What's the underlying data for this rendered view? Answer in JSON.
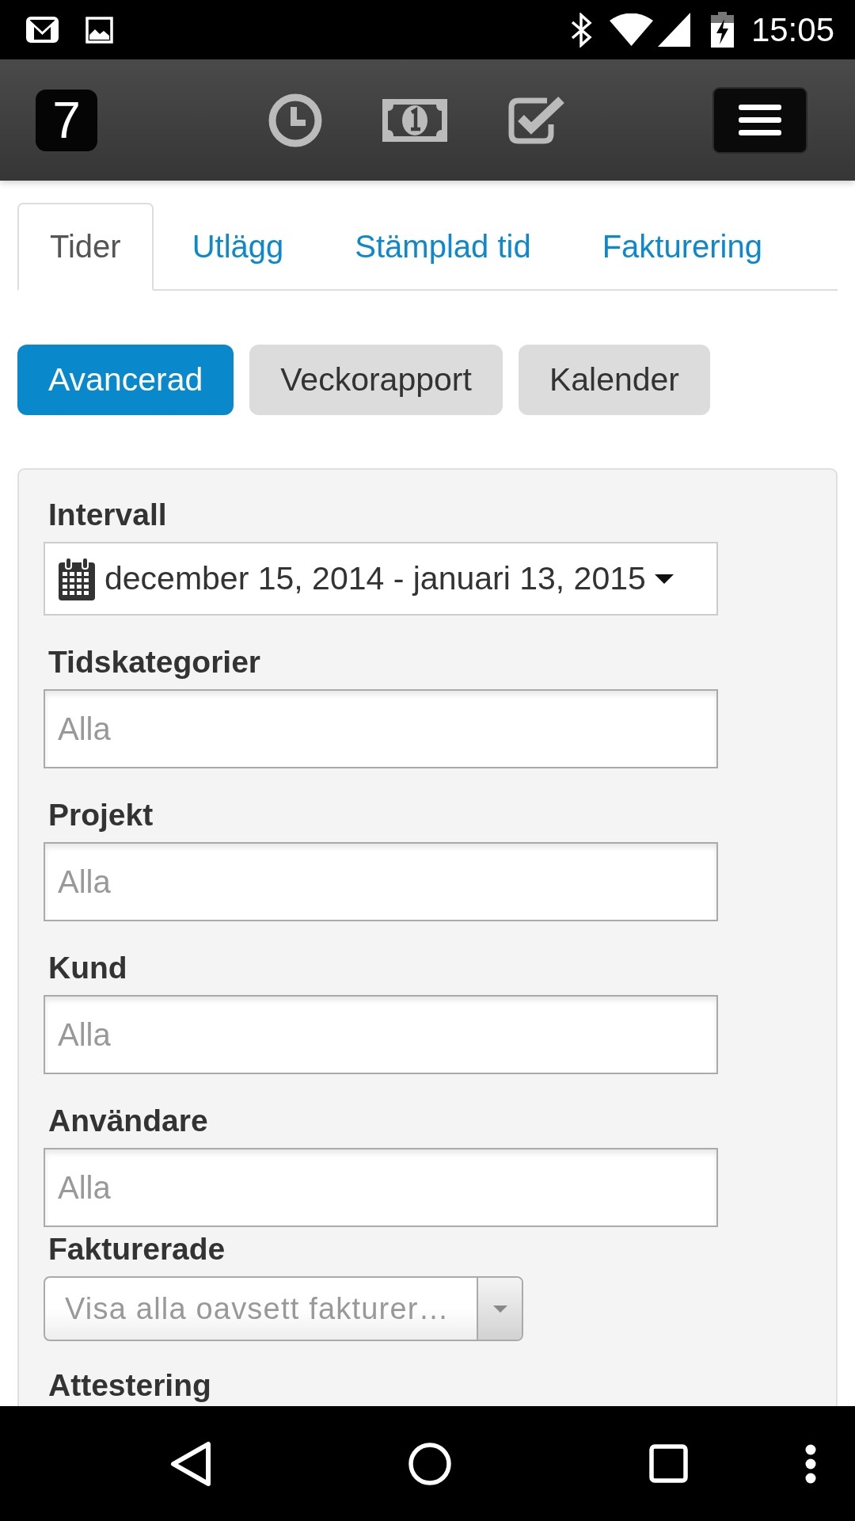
{
  "status_bar": {
    "time": "15:05"
  },
  "header": {
    "logo": "7"
  },
  "tabs": [
    {
      "label": "Tider",
      "selected": true
    },
    {
      "label": "Utlägg",
      "selected": false
    },
    {
      "label": "Stämplad tid",
      "selected": false
    },
    {
      "label": "Fakturering",
      "selected": false
    }
  ],
  "view_buttons": [
    {
      "label": "Avancerad",
      "selected": true
    },
    {
      "label": "Veckorapport",
      "selected": false
    },
    {
      "label": "Kalender",
      "selected": false
    }
  ],
  "filters": [
    {
      "kind": "daterange",
      "label": "Intervall",
      "value": "december 15, 2014 - januari 13, 2015"
    },
    {
      "kind": "text",
      "label": "Tidskategorier",
      "placeholder": "Alla"
    },
    {
      "kind": "text",
      "label": "Projekt",
      "placeholder": "Alla"
    },
    {
      "kind": "text",
      "label": "Kund",
      "placeholder": "Alla"
    },
    {
      "kind": "text",
      "label": "Användare",
      "placeholder": "Alla"
    },
    {
      "kind": "select",
      "label": "Fakturerade",
      "placeholder": "Visa alla oavsett fakturer…"
    },
    {
      "kind": "heading",
      "label": "Attestering"
    }
  ]
}
